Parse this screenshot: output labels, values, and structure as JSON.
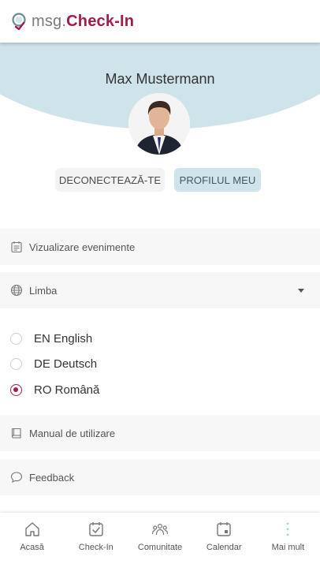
{
  "header": {
    "brand_light": "msg.",
    "brand_bold": "Check-In",
    "logo_icon": "location-pin-check-icon"
  },
  "profile": {
    "name": "Max Mustermann",
    "logout_label": "DECONECTEAZĂ-TE",
    "profile_label": "PROFILUL MEU"
  },
  "menu": {
    "events_label": "Vizualizare evenimente",
    "language_label": "Limba",
    "manual_label": "Manual de utilizare",
    "feedback_label": "Feedback"
  },
  "languages": [
    {
      "label": "EN English",
      "selected": false
    },
    {
      "label": "DE Deutsch",
      "selected": false
    },
    {
      "label": "RO Română",
      "selected": true
    }
  ],
  "bottom_nav": [
    {
      "label": "Acasă",
      "icon": "home-icon"
    },
    {
      "label": "Check-In",
      "icon": "checkin-calendar-icon"
    },
    {
      "label": "Comunitate",
      "icon": "community-icon"
    },
    {
      "label": "Calendar",
      "icon": "calendar-icon"
    },
    {
      "label": "Mai mult",
      "icon": "more-vertical-icon"
    }
  ],
  "colors": {
    "brand": "#a41b4d",
    "hero": "#cfe3ea",
    "row_bg": "#f7f7f7"
  }
}
